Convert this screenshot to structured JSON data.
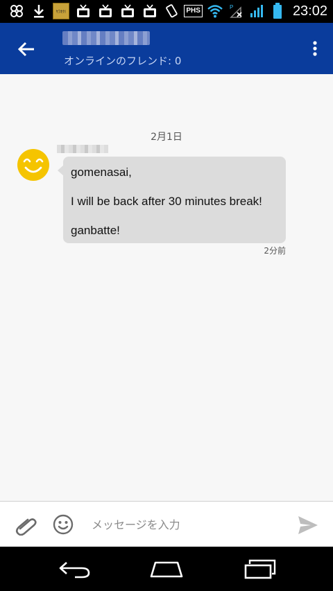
{
  "status_bar": {
    "time": "23:02",
    "ad_badge_text": "ﾔﾌｵｸ!",
    "phs_label": "PHS",
    "icons": [
      "app-icon",
      "download-icon",
      "ad-icon",
      "tv-icon",
      "tv-icon",
      "tv-icon",
      "tv-icon",
      "vibrate-icon",
      "phs-icon",
      "wifi-icon",
      "signal-icon",
      "signal-bars-icon",
      "battery-icon"
    ]
  },
  "app_bar": {
    "subtitle": "オンラインのフレンド: 0"
  },
  "chat": {
    "date_divider": "2月1日",
    "message": {
      "lines": [
        "gomenasai,",
        "I will be back after 30 minutes break!",
        "ganbatte!"
      ],
      "timestamp": "2分前"
    }
  },
  "composer": {
    "placeholder": "メッセージを入力",
    "value": ""
  },
  "colors": {
    "app_bar": "#0a3c9c",
    "bubble": "#dcdcdc",
    "avatar": "#f5c400"
  }
}
